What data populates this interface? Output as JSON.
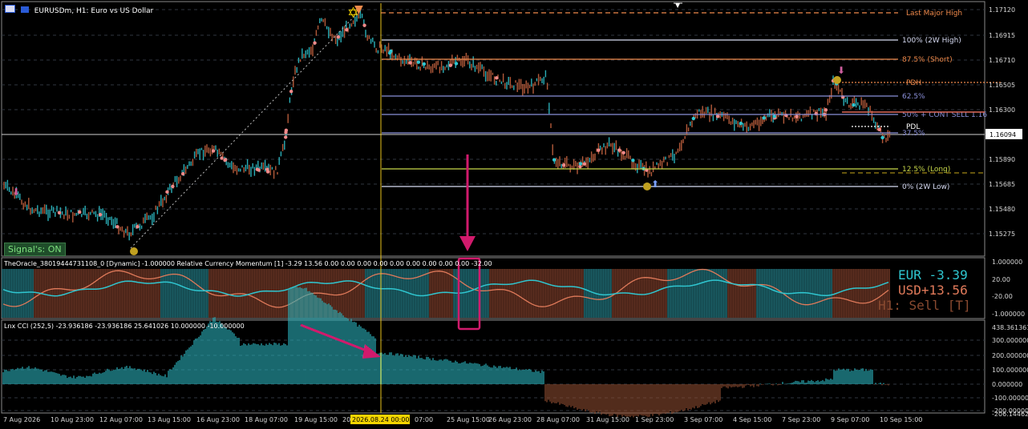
{
  "window": {
    "symbol_title": "EURUSDm, H1: Euro vs US Dollar",
    "signals": "Signal's: ON"
  },
  "indicator1": {
    "title": "TheOracle_38019444731108_0 [Dynamic] -1.000000 Relative Currency Momentum [1] -3.29 13.56 0.00 0.00 0.00 0.00 0.00 0.00 0.00 0.00 0.00 -32.00",
    "eur": "EUR  -3.39",
    "usd": "USD+13.56",
    "signal": "H1: Sell [T]",
    "scale": [
      "1.000000",
      "20.00",
      "-20.00",
      "-1.000000"
    ]
  },
  "indicator2": {
    "title": "Lnx CCI (252,5) -23.936186 -23.936186 25.641026 10.000000 -10.000000",
    "scale": [
      "438.361361",
      "300.000000",
      "200.000000",
      "100.000000",
      "0.000000",
      "-100.000000",
      "-200.000000",
      "-206.144622"
    ]
  },
  "price_axis": [
    "1.17120",
    "1.16915",
    "1.16710",
    "1.16505",
    "1.16300",
    "1.16094",
    "1.15890",
    "1.15685",
    "1.15480",
    "1.15275"
  ],
  "current_price": "1.16094",
  "levels": [
    {
      "label": "Last Major High",
      "color": "#f08a4b"
    },
    {
      "label": "100% (2W High)",
      "color": "#d8dcf4"
    },
    {
      "label": "87.5% (Short)",
      "color": "#f08a4b"
    },
    {
      "label": "PDH",
      "color": "#f08a4b"
    },
    {
      "label": "62.5%",
      "color": "#8a8fd8"
    },
    {
      "label": "50% + CONT SELL 1.16",
      "color": "#8a8fd8"
    },
    {
      "label": "PDL",
      "color": "#ffffff"
    },
    {
      "label": "37.5%",
      "color": "#8a8fd8"
    },
    {
      "label": "12.5% (Long)",
      "color": "#c8d84a"
    },
    {
      "label": "0% (2W Low)",
      "color": "#d8dcf4"
    }
  ],
  "time_axis": [
    "7 Aug 2026",
    "10 Aug 23:00",
    "12 Aug 07:00",
    "13 Aug 15:00",
    "16 Aug 23:00",
    "18 Aug 07:00",
    "19 Aug 15:00",
    "20",
    "2026.08.24 00:00",
    "07:00",
    "25 Aug 15:00",
    "26 Aug 23:00",
    "28 Aug 07:00",
    "31 Aug 15:00",
    "1 Sep 23:00",
    "3 Sep 07:00",
    "4 Sep 15:00",
    "7 Sep 23:00",
    "9 Sep 07:00",
    "10 Sep 15:00"
  ],
  "colors": {
    "background": "#000000",
    "grid": "#2f3640",
    "bull": "#2aaeb7",
    "bear": "#8a4a30",
    "momentum_line": "#2fc6d0",
    "usd_line": "#e07a5a",
    "annotation": "#d11a6c",
    "vline": "#e8c21a"
  }
}
